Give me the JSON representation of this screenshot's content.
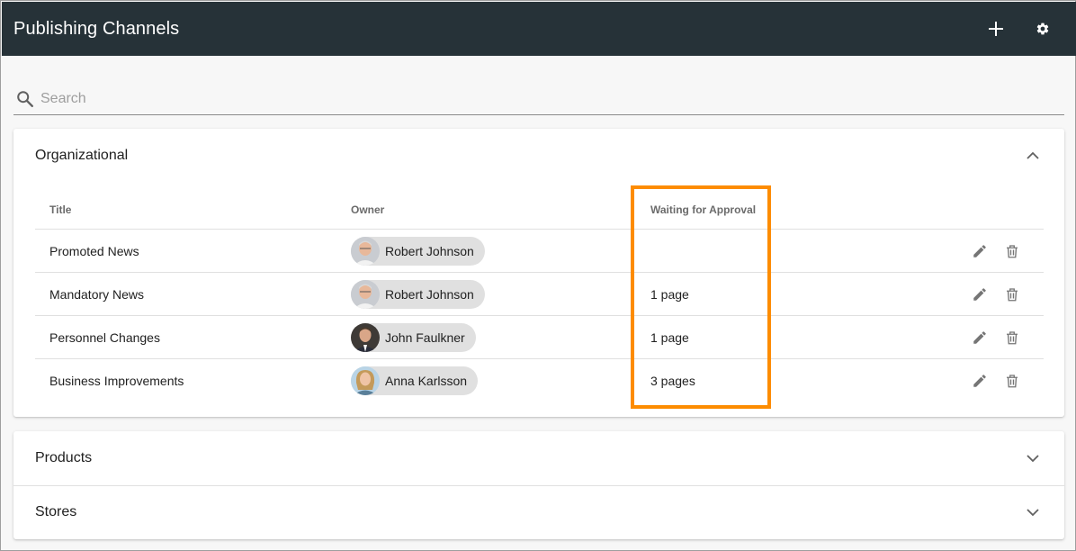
{
  "header": {
    "title": "Publishing Channels",
    "add_icon": "plus-icon",
    "settings_icon": "gear-icon"
  },
  "search": {
    "placeholder": "Search",
    "value": "",
    "icon": "search-icon"
  },
  "groups": [
    {
      "title": "Organizational",
      "expanded": true,
      "columns": {
        "title": "Title",
        "owner": "Owner",
        "waiting": "Waiting for Approval"
      },
      "rows": [
        {
          "title": "Promoted News",
          "owner": "Robert Johnson",
          "waiting": ""
        },
        {
          "title": "Mandatory News",
          "owner": "Robert Johnson",
          "waiting": "1 page"
        },
        {
          "title": "Personnel Changes",
          "owner": "John Faulkner",
          "waiting": "1 page"
        },
        {
          "title": "Business Improvements",
          "owner": "Anna Karlsson",
          "waiting": "3 pages"
        }
      ]
    },
    {
      "title": "Products",
      "expanded": false
    },
    {
      "title": "Stores",
      "expanded": false
    }
  ],
  "colors": {
    "header_bg": "#263238",
    "highlight": "#fd8c00",
    "chip_bg": "#e0e0e0"
  }
}
